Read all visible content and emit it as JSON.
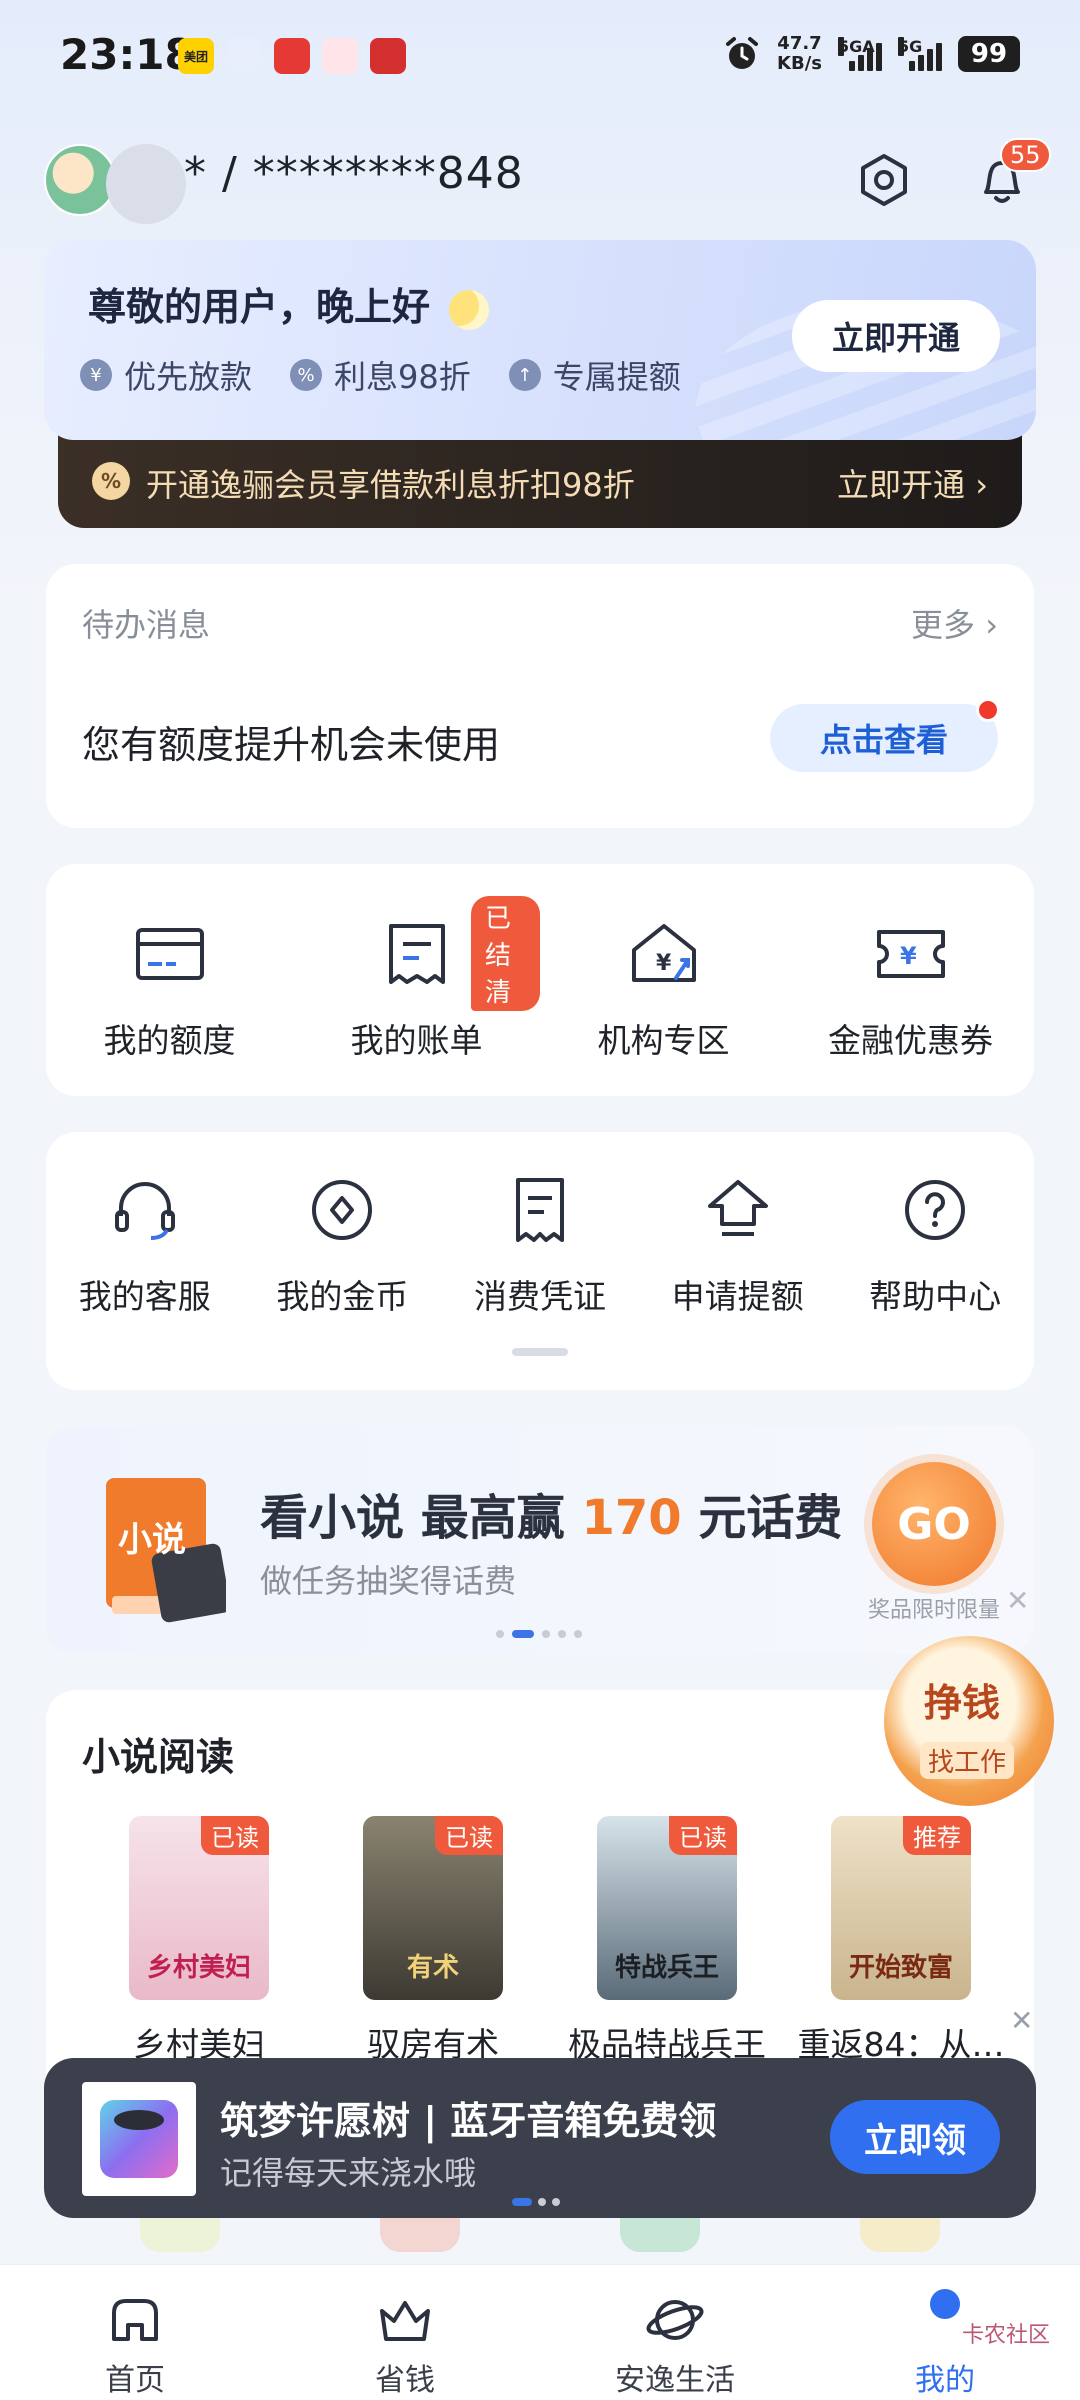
{
  "status_bar": {
    "time": "23:18",
    "net_speed_value": "47.7",
    "net_speed_unit": "KB/s",
    "signal1_label": "5GA",
    "signal2_label": "5G",
    "battery": "99",
    "apps": [
      {
        "name": "meituan",
        "label": "美团",
        "color": "#ffd100",
        "text_color": "#222"
      },
      {
        "name": "app2",
        "label": "",
        "color": "#e8eefb",
        "text_color": "#1f5fd6"
      },
      {
        "name": "app3",
        "label": "",
        "color": "#e53935",
        "text_color": "#fff"
      },
      {
        "name": "app4",
        "label": "",
        "color": "#ffe4ea",
        "text_color": "#e0306a"
      },
      {
        "name": "app5",
        "label": "",
        "color": "#d32f2f",
        "text_color": "#fff"
      }
    ]
  },
  "header": {
    "account_name": "* / ********848",
    "notification_count": "55"
  },
  "member": {
    "greeting": "尊敬的用户，晚上好",
    "perks": [
      "优先放款",
      "利息98折",
      "专属提额"
    ],
    "perk_icons": [
      "¥",
      "%",
      "↑"
    ],
    "open_button": "立即开通",
    "strip_text": "开通逸骊会员享借款利息折扣98折",
    "strip_link": "立即开通 ›"
  },
  "todo": {
    "title": "待办消息",
    "more": "更多 ›",
    "message": "您有额度提升机会未使用",
    "button": "点击查看"
  },
  "grid_primary": [
    {
      "label": "我的额度",
      "icon": "card-icon"
    },
    {
      "label": "我的账单",
      "icon": "bill-icon",
      "tag": "已结清"
    },
    {
      "label": "机构专区",
      "icon": "institution-icon"
    },
    {
      "label": "金融优惠券",
      "icon": "coupon-icon"
    }
  ],
  "grid_secondary": [
    {
      "label": "我的客服",
      "icon": "headset-icon"
    },
    {
      "label": "我的金币",
      "icon": "coin-icon"
    },
    {
      "label": "消费凭证",
      "icon": "receipt-icon"
    },
    {
      "label": "申请提额",
      "icon": "raise-limit-icon"
    },
    {
      "label": "帮助中心",
      "icon": "help-icon"
    }
  ],
  "banner": {
    "book_label": "小说",
    "title_prefix": "看小说 最高赢",
    "title_highlight": "170",
    "title_suffix": "元话费",
    "subtitle": "做任务抽奖得话费",
    "go": "GO",
    "limit_note": "奖品限时限量",
    "close": "✕"
  },
  "earn": {
    "top": "挣钱",
    "bottom": "找工作"
  },
  "novels": {
    "title": "小说阅读",
    "close": "✕",
    "items": [
      {
        "name": "乡村美妇",
        "tag": "已读",
        "cover_text": "乡村美妇",
        "bg": "linear-gradient(180deg,#f6e3ea,#e9b9c9)",
        "fg": "#c02050"
      },
      {
        "name": "驭房有术",
        "tag": "已读",
        "cover_text": "有术",
        "bg": "linear-gradient(180deg,#8a8370,#3d3a33)",
        "fg": "#f1d27a"
      },
      {
        "name": "极品特战兵王",
        "tag": "已读",
        "cover_text": "特战兵王",
        "bg": "linear-gradient(180deg,#d6e3ea,#5a6b78)",
        "fg": "#1b1e22"
      },
      {
        "name": "重返84：从…",
        "tag": "推荐",
        "cover_text": "开始致富",
        "bg": "linear-gradient(180deg,#efe2c8,#c9b48d)",
        "fg": "#7a2a12"
      }
    ]
  },
  "popup": {
    "title": "筑梦许愿树 | 蓝牙音箱免费领",
    "subtitle": "记得每天来浇水哦",
    "button": "立即领"
  },
  "nav": {
    "items": [
      {
        "label": "首页",
        "icon": "home-icon"
      },
      {
        "label": "省钱",
        "icon": "crown-icon"
      },
      {
        "label": "安逸生活",
        "icon": "planet-icon"
      },
      {
        "label": "我的",
        "icon": "profile-icon"
      }
    ],
    "watermark": "卡农社区"
  },
  "colors": {
    "accent": "#2f6ff0",
    "badge": "#ef5a3c",
    "highlight": "#f07b2c"
  }
}
